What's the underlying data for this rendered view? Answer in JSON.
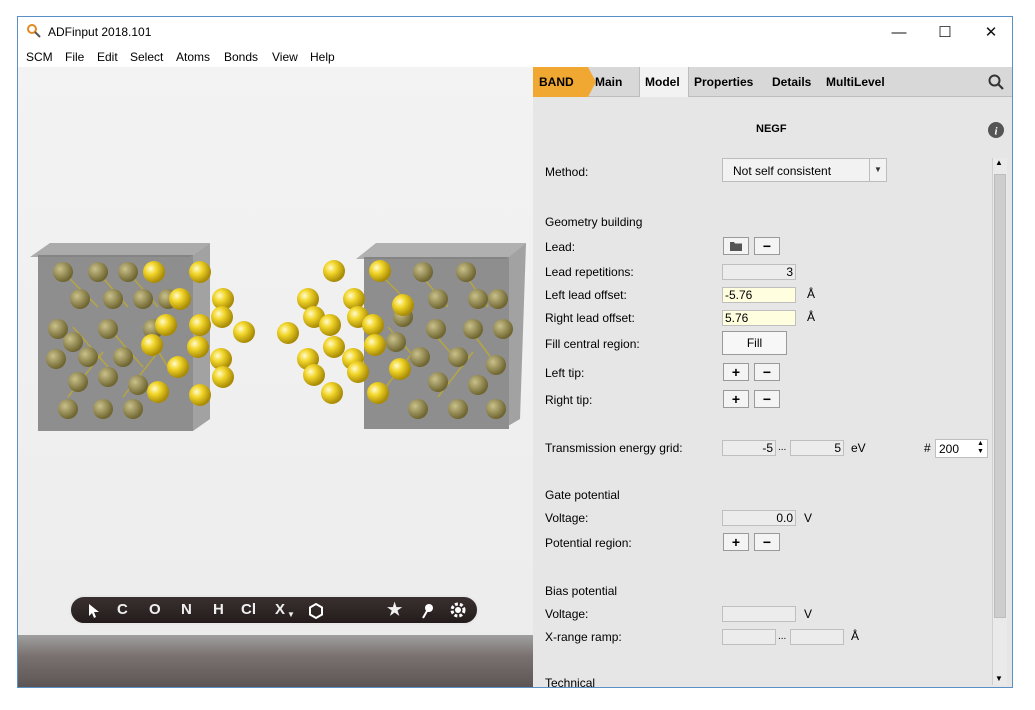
{
  "window": {
    "title": "ADFinput 2018.101",
    "min": "—",
    "max": "☐",
    "close": "✕"
  },
  "menu": [
    "SCM",
    "File",
    "Edit",
    "Select",
    "Atoms",
    "Bonds",
    "View",
    "Help"
  ],
  "tabs": [
    "BAND",
    "Main",
    "Model",
    "Properties",
    "Details",
    "MultiLevel"
  ],
  "panel": {
    "heading": "NEGF",
    "method_label": "Method:",
    "method_value": "Not self consistent",
    "geometry_heading": "Geometry building",
    "lead_label": "Lead:",
    "lead_reps_label": "Lead repetitions:",
    "lead_reps_value": "3",
    "left_offset_label": "Left lead offset:",
    "left_offset_value": "-5.76",
    "right_offset_label": "Right lead offset:",
    "right_offset_value": "5.76",
    "angstrom": "Å",
    "fill_label": "Fill central region:",
    "fill_button": "Fill",
    "left_tip_label": "Left tip:",
    "right_tip_label": "Right tip:",
    "transmission_label": "Transmission energy grid:",
    "trans_min": "-5",
    "trans_max": "5",
    "ev": "eV",
    "hash": "#",
    "trans_count": "200",
    "ellipsis": "...",
    "gate_heading": "Gate potential",
    "voltage_label": "Voltage:",
    "gate_voltage_value": "0.0",
    "v_unit": "V",
    "potential_region_label": "Potential region:",
    "bias_heading": "Bias potential",
    "bias_voltage_value": "",
    "xrange_label": "X-range ramp:",
    "technical_heading": "Technical",
    "plus": "+",
    "minus": "−"
  },
  "toolbar": [
    "C",
    "O",
    "N",
    "H",
    "Cl",
    "X"
  ],
  "colors": {
    "accent": "#f0a832",
    "atom": "#f2d62a",
    "lead_box": "#8a8a8a"
  }
}
